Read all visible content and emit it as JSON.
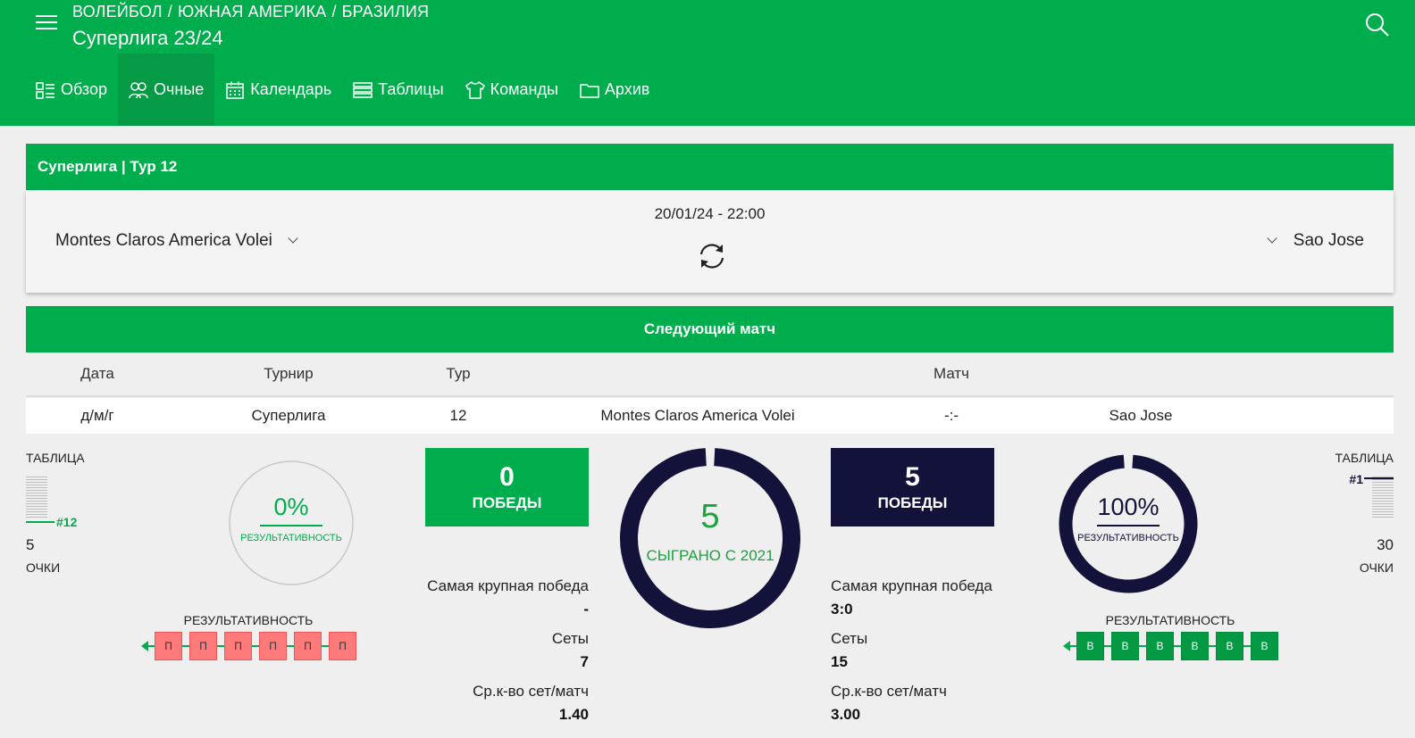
{
  "header": {
    "breadcrumb": [
      "ВОЛЕЙБОЛ",
      "ЮЖНАЯ АМЕРИКА",
      "БРАЗИЛИЯ"
    ],
    "separator": "/",
    "title": "Суперлига 23/24"
  },
  "tabs": [
    {
      "label": "Обзор",
      "icon": "overview-icon",
      "active": false
    },
    {
      "label": "Очные",
      "icon": "head-to-head-icon",
      "active": true
    },
    {
      "label": "Календарь",
      "icon": "calendar-icon",
      "active": false
    },
    {
      "label": "Таблицы",
      "icon": "tables-icon",
      "active": false
    },
    {
      "label": "Команды",
      "icon": "jersey-icon",
      "active": false
    },
    {
      "label": "Архив",
      "icon": "folder-icon",
      "active": false
    }
  ],
  "match": {
    "heading": "Суперлига | Тур 12",
    "datetime": "20/01/24 - 22:00",
    "home": "Montes Claros America Volei",
    "away": "Sao Jose"
  },
  "next_match": {
    "heading": "Следующий матч",
    "columns": [
      "Дата",
      "Турнир",
      "Тур",
      "Матч"
    ],
    "row": {
      "date": "д/м/г",
      "tournament": "Суперлига",
      "round": "12",
      "home": "Montes Claros America Volei",
      "score": "-:-",
      "away": "Sao Jose"
    }
  },
  "stats": {
    "center": {
      "value": "5",
      "label": "СЫГРАНО С 2021"
    },
    "home": {
      "table_label": "ТАБЛИЦА",
      "rank": "#12",
      "points": "5",
      "points_label": "ОЧКИ",
      "efficiency": "0%",
      "efficiency_fraction": 0,
      "efficiency_label": "РЕЗУЛЬТАТИВНОСТЬ",
      "wins": "0",
      "wins_label": "ПОБЕДЫ",
      "biggest_win_label": "Самая крупная победа",
      "biggest_win": "-",
      "sets_label": "Сеты",
      "sets": "7",
      "avg_label": "Ср.к-во сет/матч",
      "avg": "1.40",
      "form_label": "РЕЗУЛЬТАТИВНОСТЬ",
      "form": [
        "П",
        "П",
        "П",
        "П",
        "П",
        "П"
      ]
    },
    "away": {
      "table_label": "ТАБЛИЦА",
      "rank": "#1",
      "points": "30",
      "points_label": "ОЧКИ",
      "efficiency": "100%",
      "efficiency_fraction": 1,
      "efficiency_label": "РЕЗУЛЬТАТИВНОСТЬ",
      "wins": "5",
      "wins_label": "ПОБЕДЫ",
      "biggest_win_label": "Самая крупная победа",
      "biggest_win": "3:0",
      "sets_label": "Сеты",
      "sets": "15",
      "avg_label": "Ср.к-во сет/матч",
      "avg": "3.00",
      "form_label": "РЕЗУЛЬТАТИВНОСТЬ",
      "form": [
        "В",
        "В",
        "В",
        "В",
        "В",
        "В"
      ]
    }
  },
  "colors": {
    "brand_green": "#00ad4c",
    "navy": "#12123a",
    "loss_red": "#ff7b7b",
    "win_green": "#049a44"
  }
}
